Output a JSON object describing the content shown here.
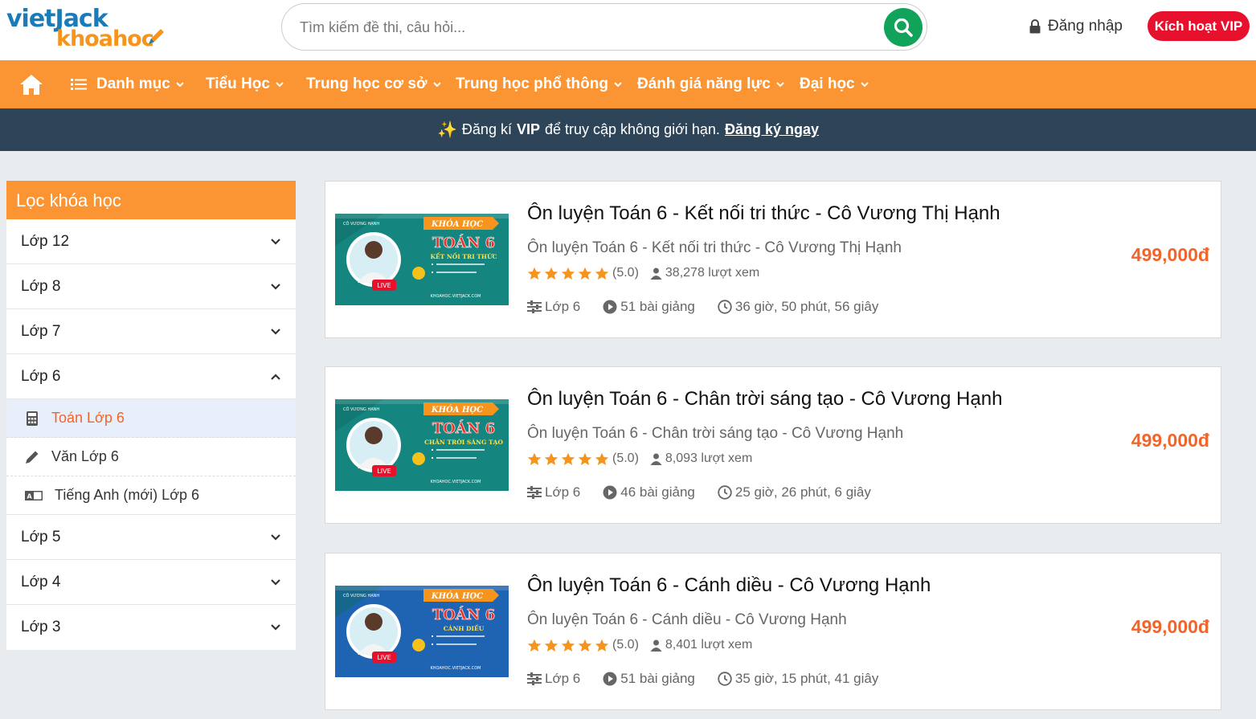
{
  "logo": {
    "line1": "vietJack",
    "line2": "khoahoc"
  },
  "search": {
    "placeholder": "Tìm kiếm đề thi, câu hỏi..."
  },
  "header": {
    "login": "Đăng nhập",
    "vip": "Kích hoạt VIP"
  },
  "nav": {
    "items": [
      "Danh mục",
      "Tiểu Học",
      "Trung học cơ sở",
      "Trung học phổ thông",
      "Đánh giá năng lực",
      "Đại học"
    ]
  },
  "banner": {
    "prefix": "Đăng kí",
    "vip": "VIP",
    "middle": "để truy cập không giới hạn.",
    "link": "Đăng ký ngay"
  },
  "sidebar": {
    "title": "Lọc khóa học",
    "grades": [
      "Lớp 12",
      "Lớp 8",
      "Lớp 7",
      "Lớp 6",
      "Lớp 5",
      "Lớp 4",
      "Lớp 3"
    ],
    "subjects": [
      "Toán Lớp 6",
      "Văn Lớp 6",
      "Tiếng Anh (mới) Lớp 6"
    ]
  },
  "thumb": {
    "badge": "KHÓA HỌC",
    "subject": "TOÁN 6",
    "teacher": "CÔ VƯƠNG HẠNH",
    "live": "LIVE",
    "site": "KHOAHOC.VIETJACK.COM"
  },
  "courses": [
    {
      "title": "Ôn luyện Toán 6 - Kết nối tri thức - Cô Vương Thị Hạnh",
      "subtitle": "Ôn luyện Toán 6 - Kết nối tri thức - Cô Vương Thị Hạnh",
      "rating": "(5.0)",
      "views": "38,278 lượt xem",
      "grade": "Lớp 6",
      "lessons": "51 bài giảng",
      "duration": "36 giờ, 50 phút, 56 giây",
      "price": "499,000đ",
      "series": "KẾT NỐI TRI THỨC",
      "bg": "#14857f"
    },
    {
      "title": "Ôn luyện Toán 6 - Chân trời sáng tạo - Cô Vương Hạnh",
      "subtitle": "Ôn luyện Toán 6 - Chân trời sáng tạo - Cô Vương Hạnh",
      "rating": "(5.0)",
      "views": "8,093 lượt xem",
      "grade": "Lớp 6",
      "lessons": "46 bài giảng",
      "duration": "25 giờ, 26 phút, 6 giây",
      "price": "499,000đ",
      "series": "CHÂN TRỜI SÁNG TẠO",
      "bg": "#14857f"
    },
    {
      "title": "Ôn luyện Toán 6 - Cánh diều - Cô Vương Hạnh",
      "subtitle": "Ôn luyện Toán 6 - Cánh diều - Cô Vương Hạnh",
      "rating": "(5.0)",
      "views": "8,401 lượt xem",
      "grade": "Lớp 6",
      "lessons": "51 bài giảng",
      "duration": "35 giờ, 15 phút, 41 giây",
      "price": "499,000đ",
      "series": "CÁNH DIỀU",
      "bg": "#1f63b3"
    }
  ]
}
